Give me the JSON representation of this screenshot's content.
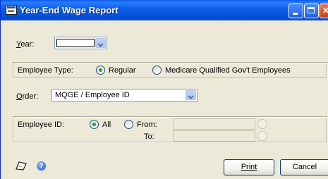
{
  "window": {
    "title": "Year-End Wage Report"
  },
  "year": {
    "label": "Year:",
    "value": ""
  },
  "employee_type": {
    "label": "Employee Type:",
    "options": [
      {
        "label": "Regular",
        "selected": true
      },
      {
        "label": "Medicare Qualified Gov't Employees",
        "selected": false
      }
    ]
  },
  "order": {
    "label": "Order:",
    "value": "MQGE / Employee ID"
  },
  "employee_id": {
    "label": "Employee ID:",
    "all_label": "All",
    "from_label": "From:",
    "to_label": "To:",
    "selected": "All"
  },
  "buttons": {
    "print": "Print",
    "cancel": "Cancel"
  },
  "icons": [
    "title-form-icon",
    "note-icon",
    "help-icon",
    "lookup-icon",
    "chevron-down-icon"
  ]
}
